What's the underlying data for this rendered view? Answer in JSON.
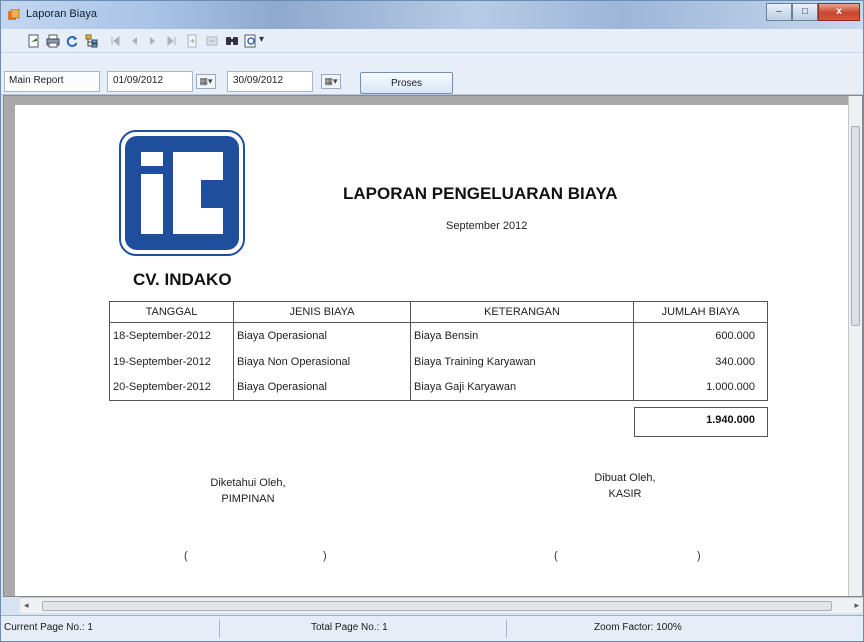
{
  "window": {
    "title": "Laporan Biaya",
    "controls": {
      "minimize": "–",
      "maximize": "□",
      "close": "x"
    }
  },
  "toolbar": {
    "icons": [
      "export-icon",
      "print-icon",
      "refresh-icon",
      "group-tree-icon",
      "first-page-icon",
      "previous-page-icon",
      "next-page-icon",
      "last-page-icon",
      "goto-page-icon",
      "stop-icon",
      "search-icon",
      "zoom-icon"
    ],
    "zoom_arrow": "▾"
  },
  "params": {
    "tab_label": "Main Report",
    "start_date": "01/09/2012",
    "end_date": "30/09/2012",
    "dropdown_glyph": "▦▾",
    "button_label": "Proses"
  },
  "report": {
    "company": "CV. INDAKO",
    "title": "LAPORAN PENGELUARAN BIAYA",
    "subtitle": "September 2012",
    "columns": [
      "TANGGAL",
      "JENIS BIAYA",
      "KETERANGAN",
      "JUMLAH BIAYA"
    ],
    "rows": [
      [
        "18-September-2012",
        "Biaya Operasional",
        "Biaya Bensin",
        "600.000"
      ],
      [
        "19-September-2012",
        "Biaya Non Operasional",
        "Biaya Training Karyawan",
        "340.000"
      ],
      [
        "20-September-2012",
        "Biaya Operasional",
        "Biaya Gaji Karyawan",
        "1.000.000"
      ]
    ],
    "total": "1.940.000",
    "signatures": {
      "left": {
        "line1": "Diketahui Oleh,",
        "line2": "PIMPINAN"
      },
      "right": {
        "line1": "Dibuat Oleh,",
        "line2": "KASIR"
      }
    },
    "paren_open": "(",
    "paren_close": ")"
  },
  "status": {
    "current_page": "Current Page No.: 1",
    "total_page": "Total Page No.: 1",
    "zoom": "Zoom Factor: 100%"
  },
  "colors": {
    "logo_blue": "#1f4f9c",
    "title_bar": "#a9c3e6",
    "close_button": "#c9452f"
  }
}
